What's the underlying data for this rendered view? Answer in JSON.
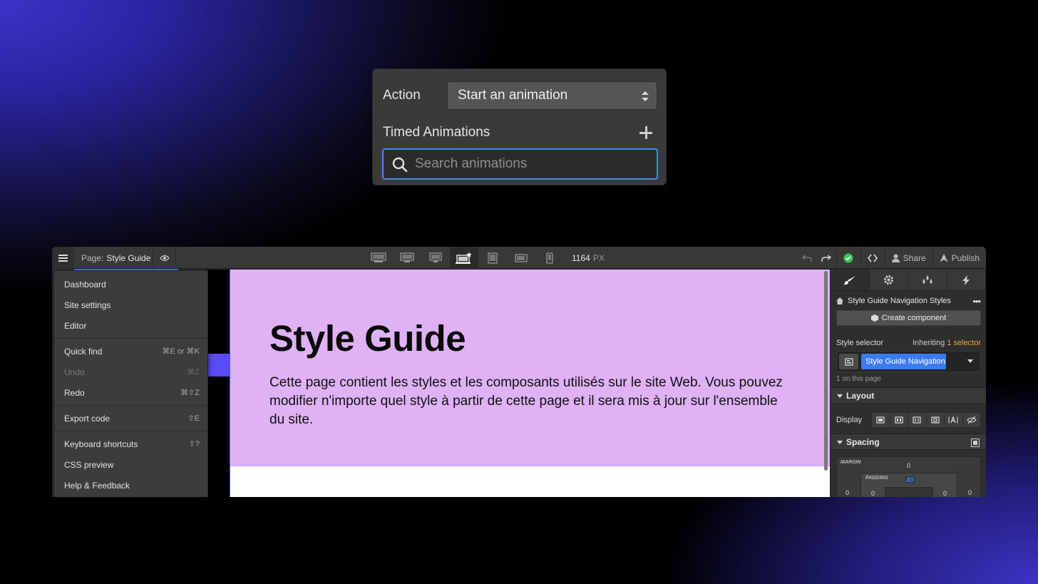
{
  "action_panel": {
    "action_label": "Action",
    "action_value": "Start an animation",
    "timed_label": "Timed Animations",
    "search_placeholder": "Search animations"
  },
  "topbar": {
    "page_prefix": "Page:",
    "page_name": "Style Guide",
    "width_value": "1164",
    "width_unit": "PX",
    "share_label": "Share",
    "publish_label": "Publish",
    "devices": [
      "desktop-xl-icon",
      "desktop-large-icon",
      "desktop-medium-icon",
      "desktop-base-icon",
      "tablet-icon",
      "mobile-landscape-icon",
      "mobile-portrait-icon"
    ],
    "status_color": "#3fc35a"
  },
  "menu": {
    "items": [
      {
        "label": "Dashboard",
        "shortcut": ""
      },
      {
        "label": "Site settings",
        "shortcut": ""
      },
      {
        "label": "Editor",
        "shortcut": ""
      },
      {
        "label": "Quick find",
        "shortcut": "⌘E or ⌘K"
      },
      {
        "label": "Undo",
        "shortcut": "⌘Z"
      },
      {
        "label": "Redo",
        "shortcut": "⌘⇧Z"
      },
      {
        "label": "Export code",
        "shortcut": "⇧E"
      },
      {
        "label": "Keyboard shortcuts",
        "shortcut": "⇧?"
      },
      {
        "label": "CSS preview",
        "shortcut": ""
      },
      {
        "label": "Help & Feedback",
        "shortcut": ""
      }
    ]
  },
  "canvas": {
    "title": "Style Guide",
    "body": "Cette page contient les styles et les composants utilisés sur le site Web. Vous pouvez modifier n'importe quel style à partir de cette page et il sera mis à jour sur l'ensemble du site.",
    "hero_color": "#dfb1f5"
  },
  "right_panel": {
    "element_name": "Style Guide Navigation Styles",
    "create_component": "Create component",
    "style_selector_label": "Style selector",
    "inheriting_prefix": "Inheriting",
    "inheriting_count": "1 selector",
    "selector_chip": "Style Guide Navigation",
    "on_page": "1 on this page",
    "layout_label": "Layout",
    "display_label": "Display",
    "spacing_label": "Spacing",
    "margin_label": "MARGIN",
    "padding_label": "PADDING",
    "margin_top": "0",
    "padding_top": "40",
    "margin_left": "0",
    "padding_left": "0",
    "padding_right": "0",
    "margin_right": "0",
    "accent": "#3a7bef"
  }
}
